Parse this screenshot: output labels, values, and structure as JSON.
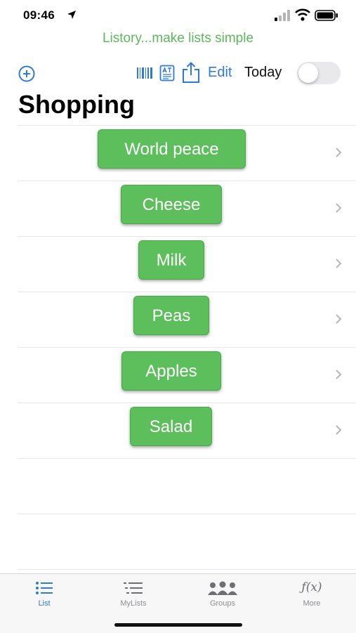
{
  "status_bar": {
    "time": "09:46"
  },
  "header": {
    "tagline": "Listory...make lists simple"
  },
  "toolbar": {
    "edit_label": "Edit",
    "today_label": "Today",
    "today_on": false
  },
  "list": {
    "title": "Shopping",
    "items": [
      {
        "label": "World peace"
      },
      {
        "label": "Cheese"
      },
      {
        "label": "Milk"
      },
      {
        "label": "Peas"
      },
      {
        "label": "Apples"
      },
      {
        "label": "Salad"
      }
    ]
  },
  "tabbar": {
    "tabs": [
      {
        "label": "List",
        "icon": "list-icon",
        "active": true
      },
      {
        "label": "MyLists",
        "icon": "mylists-icon",
        "active": false
      },
      {
        "label": "Groups",
        "icon": "groups-icon",
        "active": false
      },
      {
        "label": "More",
        "icon": "function-icon",
        "glyph": "ƒ(x)",
        "active": false
      }
    ]
  },
  "colors": {
    "accent": "#2f7ad8",
    "item_green": "#5cbf5c",
    "tagline_green": "#5cb85c"
  }
}
